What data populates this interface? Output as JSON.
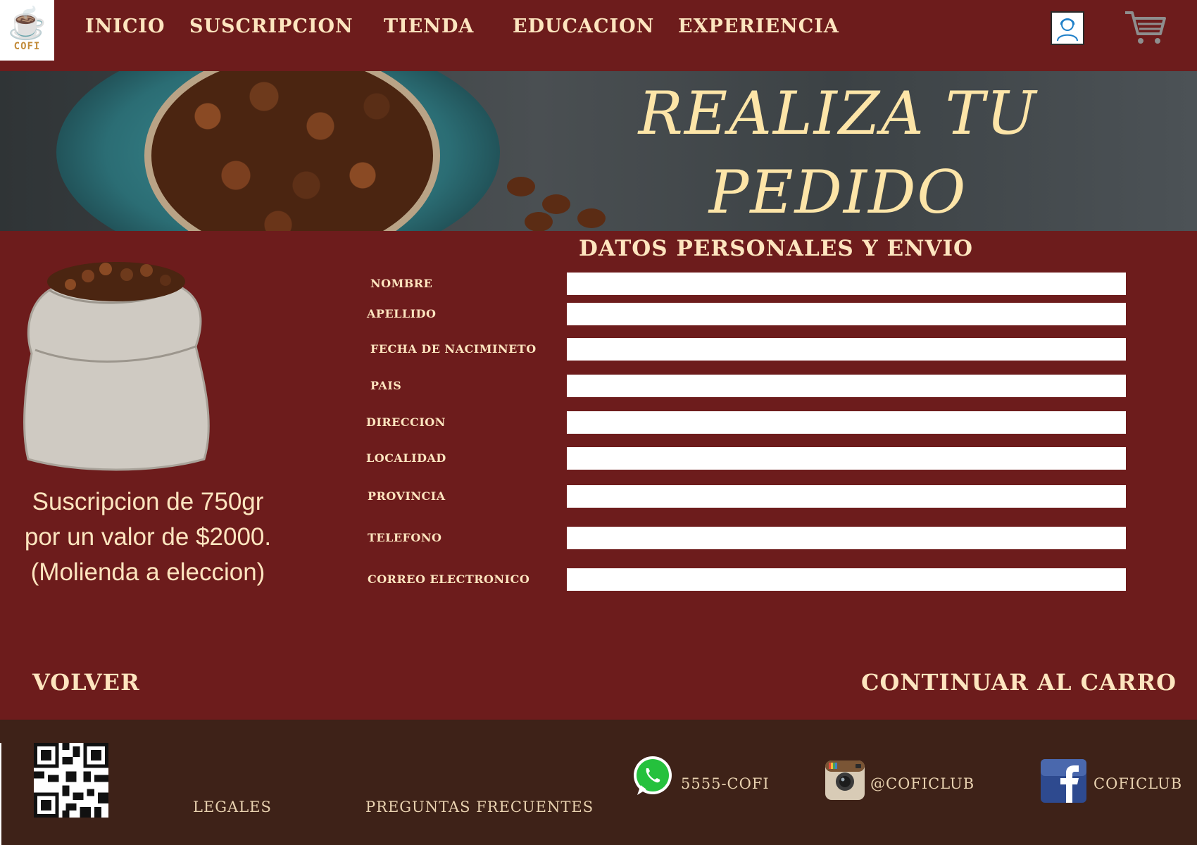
{
  "brand": {
    "logo_text": "COFI"
  },
  "nav": {
    "items": [
      "INICIO",
      "SUSCRIPCION",
      "TIENDA",
      "EDUCACION",
      "EXPERIENCIA"
    ],
    "user_icon": "user-account-icon",
    "cart_icon": "shopping-cart-icon"
  },
  "banner": {
    "title_line1": "REALIZA TU",
    "title_line2": "PEDIDO"
  },
  "product": {
    "line1": "Suscripcion de 750gr",
    "line2": "por un valor de $2000.",
    "line3": "(Molienda a eleccion)"
  },
  "form": {
    "title": "DATOS PERSONALES Y ENVIO",
    "fields": [
      {
        "label": "NOMBRE",
        "value": ""
      },
      {
        "label": "APELLIDO",
        "value": ""
      },
      {
        "label": "FECHA DE NACIMINETO",
        "value": ""
      },
      {
        "label": "PAIS",
        "value": ""
      },
      {
        "label": "DIRECCION",
        "value": ""
      },
      {
        "label": "LOCALIDAD",
        "value": ""
      },
      {
        "label": "PROVINCIA",
        "value": ""
      },
      {
        "label": "TELEFONO",
        "value": ""
      },
      {
        "label": "CORREO ELECTRONICO",
        "value": ""
      }
    ]
  },
  "actions": {
    "back": "VOLVER",
    "continue": "CONTINUAR AL CARRO"
  },
  "footer": {
    "legales": "LEGALES",
    "faq": "PREGUNTAS FRECUENTES",
    "whatsapp": "5555-COFI",
    "instagram": "@COFICLUB",
    "facebook": "COFICLUB"
  },
  "colors": {
    "background": "#6d1c1c",
    "footer": "#3e2218",
    "text_cream": "#fde5bf"
  }
}
